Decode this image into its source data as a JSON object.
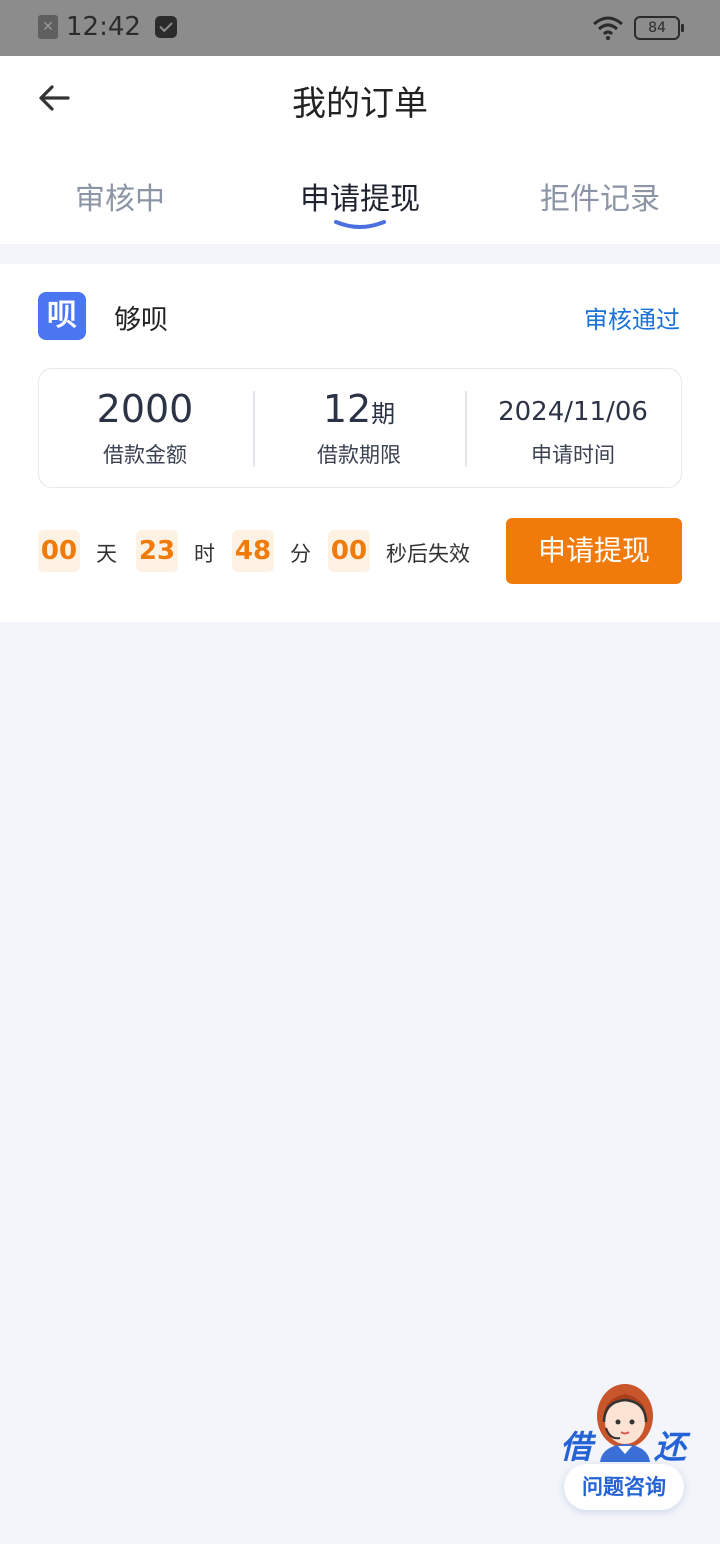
{
  "status_bar": {
    "time": "12:42",
    "battery": "84"
  },
  "header": {
    "title": "我的订单"
  },
  "tabs": [
    {
      "label": "审核中",
      "active": false
    },
    {
      "label": "申请提现",
      "active": true
    },
    {
      "label": "拒件记录",
      "active": false
    }
  ],
  "order": {
    "logo_text": "呗",
    "brand": "够呗",
    "status": "审核通过",
    "amount": "2000",
    "amount_label": "借款金额",
    "term_value": "12",
    "term_unit": "期",
    "term_label": "借款期限",
    "apply_date": "2024/11/06",
    "apply_date_label": "申请时间",
    "countdown": {
      "days": "00",
      "days_unit": "天",
      "hours": "23",
      "hours_unit": "时",
      "minutes": "48",
      "minutes_unit": "分",
      "seconds": "00",
      "seconds_unit": "秒后失效"
    },
    "action_label": "申请提现"
  },
  "consult": {
    "left": "借",
    "right": "还",
    "label": "问题咨询"
  },
  "colors": {
    "accent": "#f07a0a",
    "link": "#1a72d9",
    "brand": "#4a76f2",
    "tab_indicator": "#4a6fe0"
  }
}
